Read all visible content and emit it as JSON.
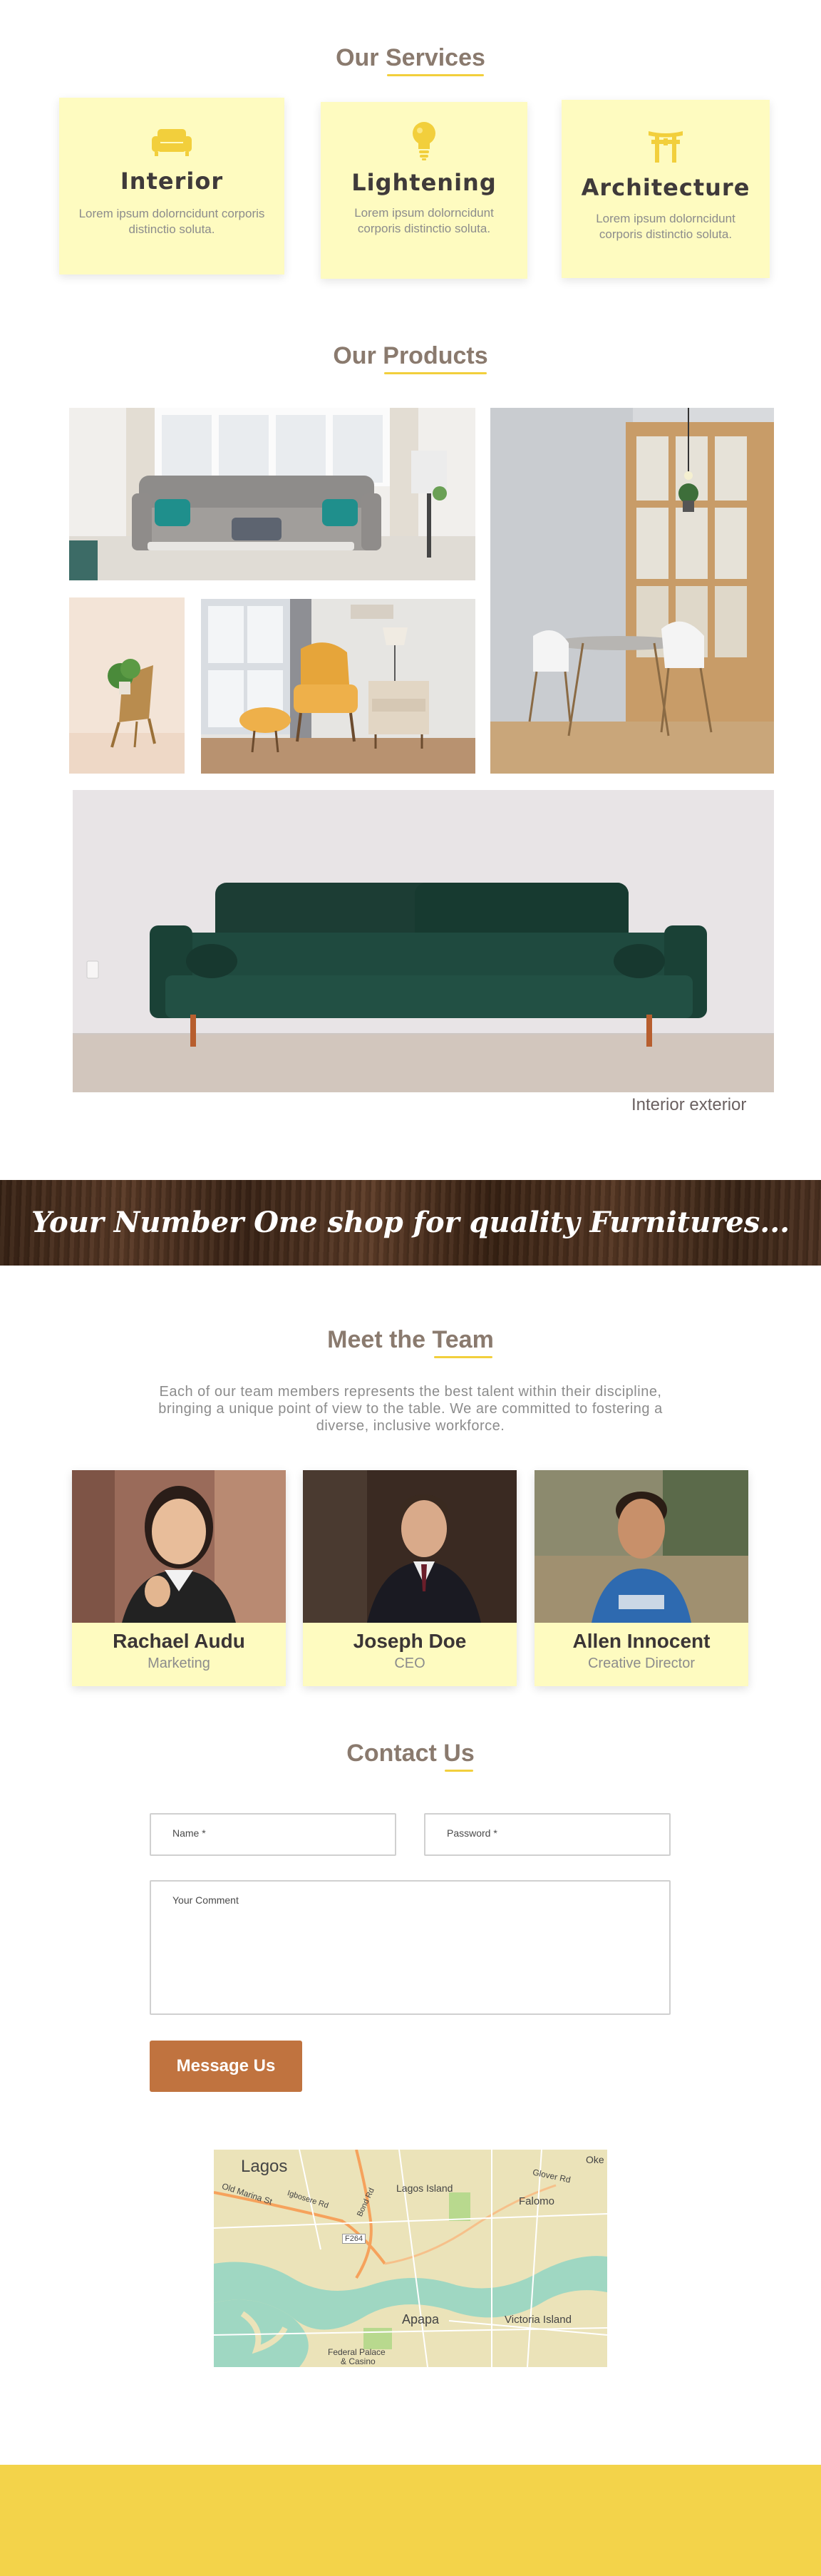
{
  "services": {
    "title_prefix": "Our ",
    "title_highlight": "Services",
    "items": [
      {
        "name": "Interior",
        "desc": "Lorem ipsum dolorncidunt corporis distinctio soluta.",
        "icon": "sofa-icon"
      },
      {
        "name": "Lightening",
        "desc": "Lorem ipsum dolorncidunt corporis distinctio soluta.",
        "icon": "lightbulb-icon"
      },
      {
        "name": "Architecture",
        "desc": "Lorem ipsum dolorncidunt corporis distinctio soluta.",
        "icon": "torii-gate-icon"
      }
    ],
    "accent": "#f2cf3c",
    "card_bg": "#fefbc0"
  },
  "products": {
    "title_prefix": "Our ",
    "title_highlight": "Products",
    "caption": "Interior exterior"
  },
  "banner": {
    "text": "Your Number One shop for quality Furnitures..."
  },
  "team": {
    "title_prefix": "Meet the ",
    "title_highlight": "Team",
    "description": "Each of our team members represents the best talent within their discipline, bringing a unique point of view to the table. We are committed to fostering a diverse, inclusive workforce.",
    "members": [
      {
        "name": "Rachael Audu",
        "role": "Marketing"
      },
      {
        "name": "Joseph Doe",
        "role": "CEO"
      },
      {
        "name": "Allen Innocent",
        "role": "Creative Director"
      }
    ]
  },
  "contact": {
    "title_prefix": "Contact ",
    "title_highlight": "Us",
    "name_placeholder": "Name *",
    "password_placeholder": "Password *",
    "comment_placeholder": "Your Comment",
    "submit_label": "Message Us",
    "button_color": "#c0733f"
  },
  "map": {
    "labels": [
      "Lagos",
      "Oke",
      "Glover Rd",
      "Lagos Island",
      "Falomo",
      "Apapa",
      "Victoria Island",
      "Old Marina St",
      "Igbosere Rd",
      "Bond Rd",
      "F264",
      "Federal Palace",
      "& Casino"
    ]
  },
  "footer": {
    "color": "#f3d34a"
  }
}
